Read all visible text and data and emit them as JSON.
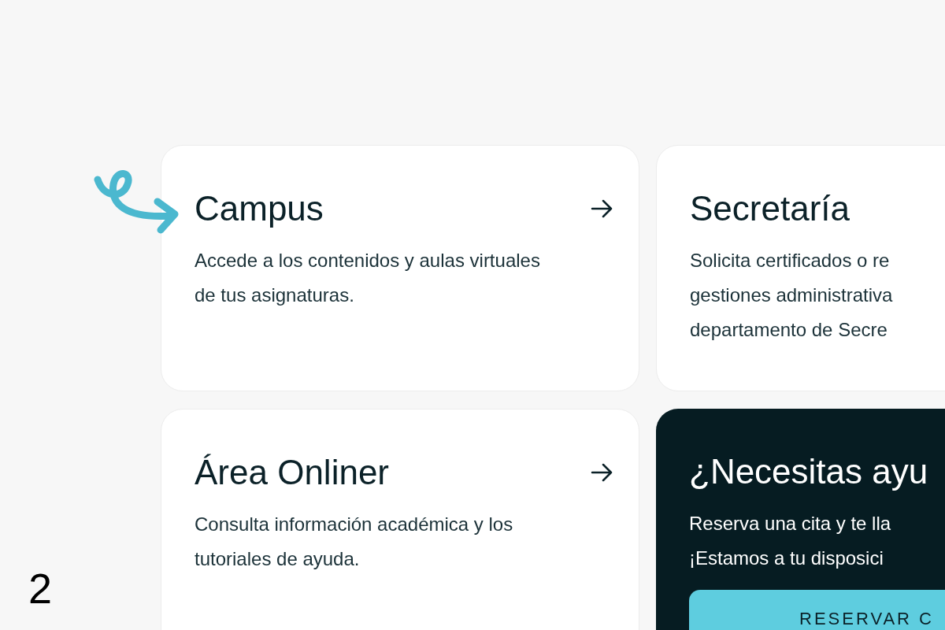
{
  "cards": [
    {
      "kind": "link",
      "title": "Campus",
      "description": "Accede a los contenidos y aulas virtuales de tus asignaturas.",
      "arrow": true,
      "highlighted": true
    },
    {
      "kind": "link",
      "title": "Secretaría",
      "description": "Solicita certificados o re\ngestiones administrativa\ndepartamento de Secre",
      "arrow": false,
      "highlighted": false
    },
    {
      "kind": "link",
      "title": "Área Onliner",
      "description": "Consulta información académica y los tutoriales de ayuda.",
      "arrow": true,
      "highlighted": false
    },
    {
      "kind": "help",
      "title": "¿Necesitas ayu",
      "description": "Reserva una cita y te lla\n¡Estamos a tu disposici",
      "button": "RESERVAR C"
    }
  ],
  "page_number": "2"
}
